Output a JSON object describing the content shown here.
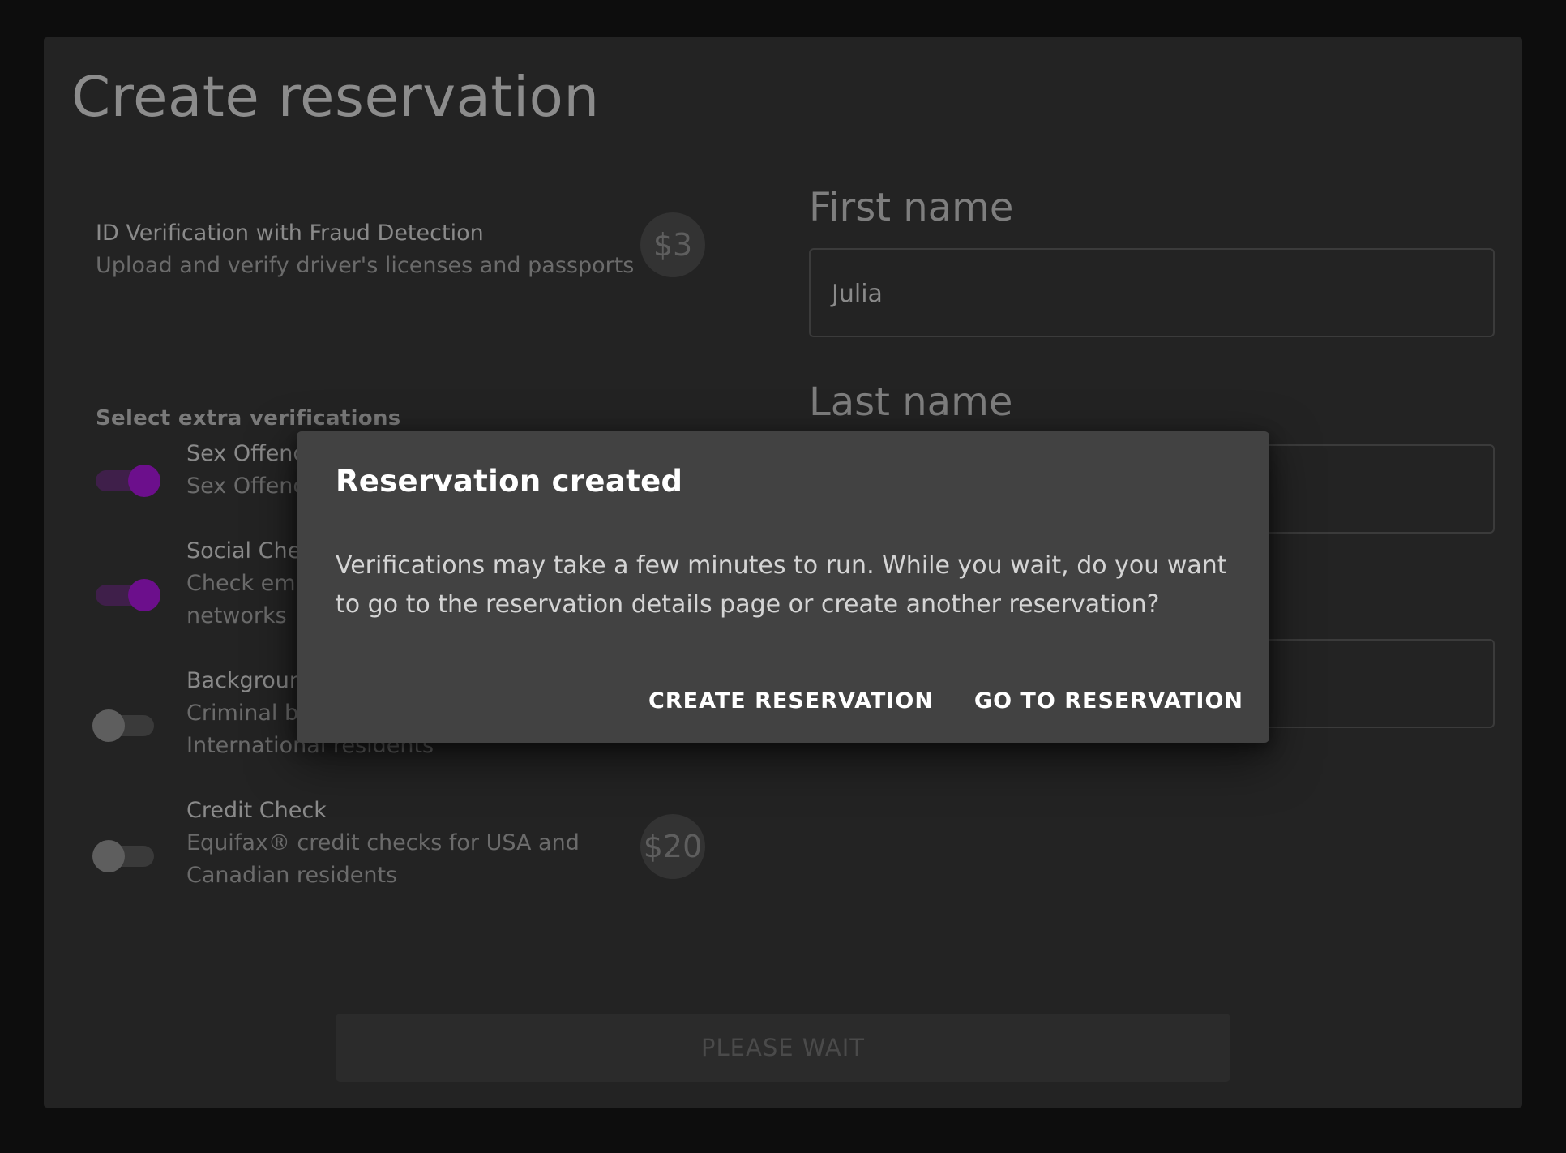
{
  "page": {
    "title": "Create reservation"
  },
  "base_verification": {
    "title": "ID Verification with Fraud Detection",
    "description": "Upload and verify driver's licenses and passports",
    "price": "$3"
  },
  "extras": {
    "section_label": "Select extra verifications",
    "options": [
      {
        "title": "Sex Offend",
        "description_lines": [
          "Sex Offend"
        ],
        "enabled": true
      },
      {
        "title": "Social Che",
        "description_lines": [
          "Check ema",
          "networks"
        ],
        "enabled": true
      },
      {
        "title": "Backgroun",
        "description_lines": [
          "Criminal ba",
          "International residents"
        ],
        "enabled": false
      },
      {
        "title": "Credit Check",
        "description_lines": [
          "Equifax® credit checks for USA and",
          "Canadian residents"
        ],
        "enabled": false,
        "price": "$20"
      }
    ]
  },
  "form": {
    "first_name_label": "First name",
    "first_name_value": "Julia",
    "last_name_label": "Last name",
    "last_name_value": ""
  },
  "submit": {
    "label": "PLEASE WAIT"
  },
  "dialog": {
    "title": "Reservation created",
    "body": "Verifications may take a few minutes to run. While you wait, do you want to go to the reservation details page or create another reservation?",
    "create_label": "CREATE RESERVATION",
    "go_label": "GO TO RESERVATION"
  },
  "colors": {
    "toggle_on": "#6c0f8c",
    "dialog_bg": "#424242",
    "card_bg": "#232323"
  }
}
